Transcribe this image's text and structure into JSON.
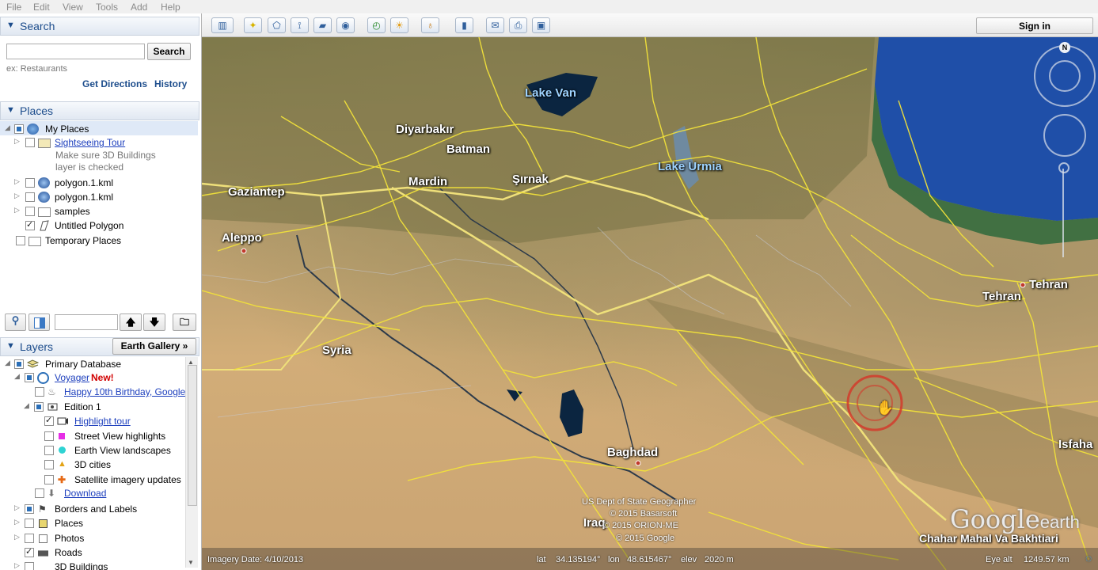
{
  "menu": [
    "File",
    "Edit",
    "View",
    "Tools",
    "Add",
    "Help"
  ],
  "search": {
    "header": "Search",
    "placeholder": "",
    "button": "Search",
    "example": "ex: Restaurants",
    "get_directions": "Get Directions",
    "history": "History"
  },
  "places": {
    "header": "Places",
    "items": [
      {
        "label": "My Places"
      },
      {
        "label": "Sightseeing Tour",
        "note1": "Make sure 3D Buildings",
        "note2": "layer is checked"
      },
      {
        "label": "polygon.1.kml"
      },
      {
        "label": "polygon.1.kml"
      },
      {
        "label": "samples"
      },
      {
        "label": "Untitled Polygon"
      },
      {
        "label": "Temporary Places"
      }
    ]
  },
  "layers": {
    "header": "Layers",
    "gallery_button": "Earth Gallery »",
    "items": [
      {
        "label": "Primary Database"
      },
      {
        "label": "Voyager",
        "badge": "New!"
      },
      {
        "label": "Happy 10th Birthday, Google"
      },
      {
        "label": "Edition 1"
      },
      {
        "label": "Highlight tour"
      },
      {
        "label": "Street View highlights"
      },
      {
        "label": "Earth View landscapes"
      },
      {
        "label": "3D cities"
      },
      {
        "label": "Satellite imagery updates"
      },
      {
        "label": "Download"
      },
      {
        "label": "Borders and Labels"
      },
      {
        "label": "Places"
      },
      {
        "label": "Photos"
      },
      {
        "label": "Roads"
      },
      {
        "label": "3D Buildings"
      }
    ]
  },
  "toolbar": {
    "sign_in": "Sign in"
  },
  "map": {
    "labels": {
      "lake_van": "Lake Van",
      "diyarbakir": "Diyarbakır",
      "batman": "Batman",
      "mardin": "Mardin",
      "sirnak": "Şırnak",
      "lake_urmia": "Lake Urmia",
      "gaziantep": "Gaziantep",
      "aleppo": "Aleppo",
      "tehran1": "Tehran",
      "tehran2": "Tehran",
      "syria": "Syria",
      "baghdad": "Baghdad",
      "iraq": "Iraq",
      "isfahan": "Isfaha",
      "region": "Chahar Mahal Va Bakhtiari"
    },
    "copyright": [
      "US Dept of State Geographer",
      "© 2015 Basarsoft",
      "© 2015 ORION-ME",
      "© 2015 Google"
    ],
    "logo": "Google",
    "logo_suffix": "earth",
    "compass_north": "N",
    "status": {
      "imagery_date": "Imagery Date: 4/10/2013",
      "lat_label": "lat",
      "lat_value": "34.135194°",
      "lon_label": "lon",
      "lon_value": "48.615467°",
      "elev_label": "elev",
      "elev_value": "2020 m",
      "eye_alt_label": "Eye alt",
      "eye_alt_value": "1249.57 km"
    }
  },
  "colors": {
    "sea": "#1f4fa8",
    "road": "#f2e23a",
    "border": "#e8d54a",
    "header_text": "#1d4d8c"
  }
}
